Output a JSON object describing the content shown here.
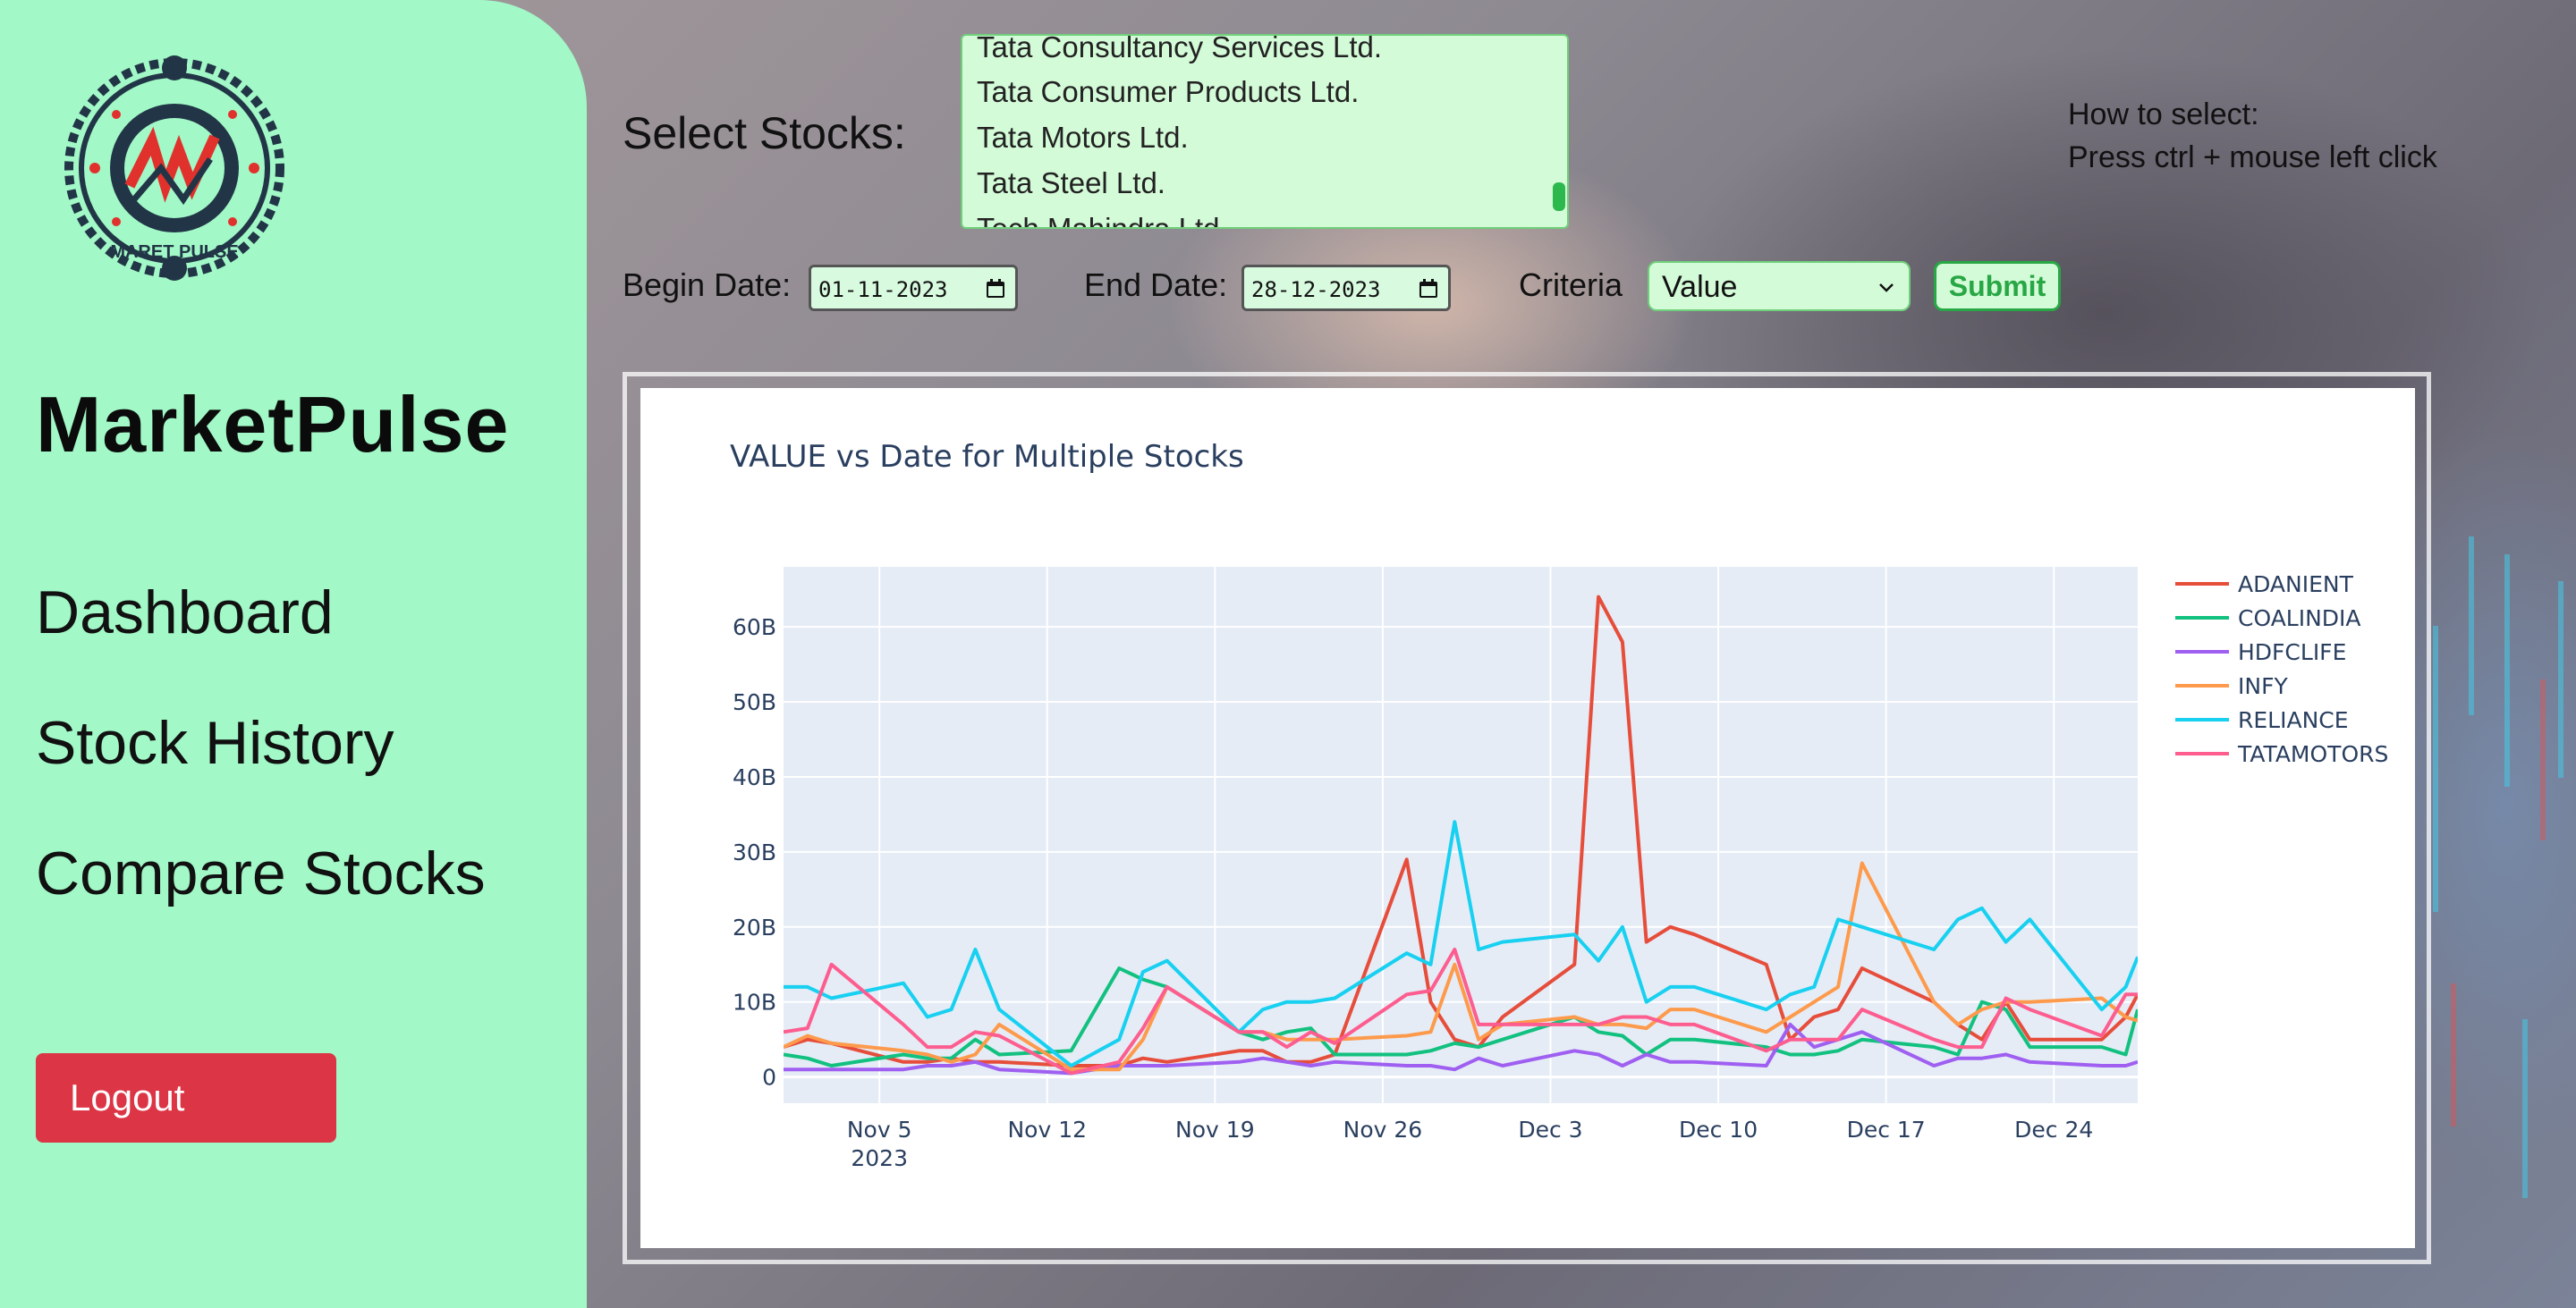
{
  "sidebar": {
    "brand": "MarketPulse",
    "logo_text": "MARET PULSE",
    "nav": [
      "Dashboard",
      "Stock History",
      "Compare Stocks"
    ],
    "logout_label": "Logout"
  },
  "controls": {
    "select_label": "Select Stocks:",
    "stock_options": [
      "Tata Consultancy Services Ltd.",
      "Tata Consumer Products Ltd.",
      "Tata Motors Ltd.",
      "Tata Steel Ltd.",
      "Tech Mahindra Ltd."
    ],
    "howto_title": "How to select:",
    "howto_text": "Press ctrl + mouse left click",
    "begin_label": "Begin Date:",
    "begin_value": "01-11-2023",
    "end_label": "End Date:",
    "end_value": "28-12-2023",
    "criteria_label": "Criteria",
    "criteria_value": "Value",
    "submit_label": "Submit"
  },
  "chart_data": {
    "type": "line",
    "title": "VALUE vs Date for Multiple Stocks",
    "xlabel": "",
    "ylabel": "",
    "x_ticks": [
      "Nov 5",
      "Nov 12",
      "Nov 19",
      "Nov 26",
      "Dec 3",
      "Dec 10",
      "Dec 17",
      "Dec 24"
    ],
    "x_tick_sub": "2023",
    "y_ticks": [
      "0",
      "10B",
      "20B",
      "30B",
      "40B",
      "50B",
      "60B"
    ],
    "ylim": [
      -3.5,
      68
    ],
    "xlim_days": [
      1,
      57.5
    ],
    "legend_position": "right",
    "x_day": [
      1,
      2,
      3,
      6,
      7,
      8,
      9,
      10,
      13,
      15,
      16,
      17,
      20,
      21,
      22,
      23,
      24,
      27,
      28,
      29,
      30,
      31,
      34,
      35,
      36,
      37,
      38,
      39,
      42,
      43,
      44,
      45,
      46,
      49,
      50,
      51,
      52,
      53,
      56,
      57,
      57.5
    ],
    "series": [
      {
        "name": "ADANIENT",
        "color": "#e64d3b",
        "values": [
          4,
          5,
          4.5,
          2,
          2,
          2.5,
          2,
          2,
          1.5,
          1.5,
          2.5,
          2,
          3.5,
          3.5,
          2,
          2,
          3,
          29,
          10,
          5,
          4,
          8,
          15,
          64,
          58,
          18,
          20,
          19,
          15,
          5,
          8,
          9,
          14.5,
          10,
          7,
          5,
          10,
          5,
          5,
          8,
          11
        ]
      },
      {
        "name": "COALINDIA",
        "color": "#12c17f",
        "values": [
          3,
          2.5,
          1.5,
          3,
          2.5,
          2.5,
          5,
          3,
          3.5,
          14.5,
          13,
          12,
          6,
          5,
          6,
          6.5,
          3,
          3,
          3.5,
          4.5,
          4,
          5,
          8,
          6,
          5.5,
          3,
          5,
          5,
          4,
          3,
          3,
          3.5,
          5,
          4,
          3,
          10,
          9,
          4,
          4,
          3,
          9
        ]
      },
      {
        "name": "HDFCLIFE",
        "color": "#9f5ff1",
        "values": [
          1,
          1,
          1,
          1,
          1.5,
          1.5,
          2,
          1,
          0.5,
          1.5,
          1.5,
          1.5,
          2,
          2.5,
          2,
          1.5,
          2,
          1.5,
          1.5,
          1,
          2.5,
          1.5,
          3.5,
          3,
          1.5,
          3,
          2,
          2,
          1.5,
          7,
          4,
          5,
          6,
          1.5,
          2.5,
          2.5,
          3,
          2,
          1.5,
          1.5,
          2
        ]
      },
      {
        "name": "INFY",
        "color": "#fd9a4c",
        "values": [
          4,
          5.5,
          4.5,
          3.5,
          3,
          2,
          3,
          7,
          1,
          1,
          5,
          12,
          6,
          6,
          5,
          5,
          5,
          5.5,
          6,
          15,
          5,
          7,
          8,
          7,
          7,
          6.5,
          9,
          9,
          6,
          8,
          10,
          12,
          28.5,
          10,
          7,
          9,
          10,
          10,
          10.5,
          8,
          7.5
        ]
      },
      {
        "name": "RELIANCE",
        "color": "#18d0f0",
        "values": [
          12,
          12,
          10.5,
          12.5,
          8,
          9,
          17,
          9,
          1.5,
          5,
          14,
          15.5,
          6,
          9,
          10,
          10,
          10.5,
          16.5,
          15,
          34,
          17,
          18,
          19,
          15.5,
          20,
          10,
          12,
          12,
          9,
          11,
          12,
          21,
          20,
          17,
          21,
          22.5,
          18,
          21,
          9,
          12,
          16
        ]
      },
      {
        "name": "TATAMOTORS",
        "color": "#fd5d8f",
        "values": [
          6,
          6.5,
          15,
          7,
          4,
          4,
          6,
          5.5,
          0.5,
          2,
          6.5,
          12,
          6,
          6,
          4,
          6,
          4.5,
          11,
          11.5,
          17,
          7,
          7,
          7,
          7,
          8,
          8,
          7,
          7,
          3.5,
          5,
          5,
          5,
          9,
          5,
          4,
          4,
          10.5,
          9,
          5.5,
          11,
          11
        ]
      }
    ]
  }
}
